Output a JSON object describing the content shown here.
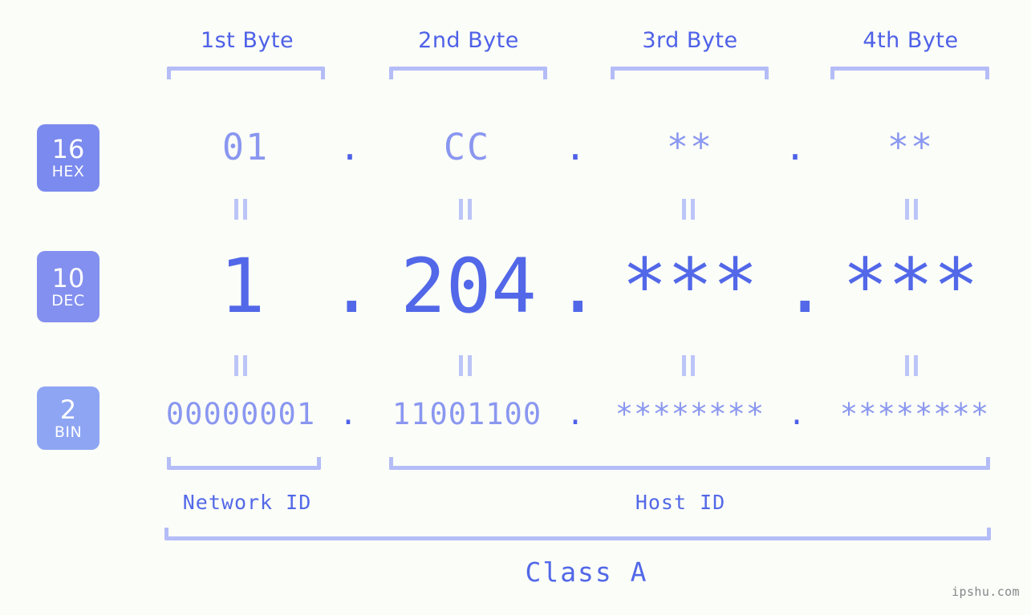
{
  "page": {
    "background_color": "#fbfdf8",
    "accent_color": "#5268e8",
    "muted_accent_color": "#8a97f0",
    "bracket_color": "#b4bdf7",
    "watermark": "ipshu.com"
  },
  "byte_headers": [
    {
      "label": "1st Byte"
    },
    {
      "label": "2nd Byte"
    },
    {
      "label": "3rd Byte"
    },
    {
      "label": "4th Byte"
    }
  ],
  "bases": [
    {
      "number": "16",
      "name": "HEX",
      "color": "#7b8aee"
    },
    {
      "number": "10",
      "name": "DEC",
      "color": "#8390ef"
    },
    {
      "number": "2",
      "name": "BIN",
      "color": "#8ea5f4"
    }
  ],
  "rows": {
    "hex": {
      "base_number": "16",
      "base_name": "HEX",
      "values": [
        "01",
        "CC",
        "**",
        "**"
      ],
      "separator": "."
    },
    "dec": {
      "base_number": "10",
      "base_name": "DEC",
      "values": [
        "1",
        "204",
        "***",
        "***"
      ],
      "separator": "."
    },
    "bin": {
      "base_number": "2",
      "base_name": "BIN",
      "values": [
        "00000001",
        "11001100",
        "********",
        "********"
      ],
      "separator": "."
    }
  },
  "equals_marks": {
    "symbol": "=",
    "count_per_gap": 4,
    "gaps": 2
  },
  "segments": {
    "network_id": "Network ID",
    "host_id": "Host ID",
    "class": "Class A"
  }
}
